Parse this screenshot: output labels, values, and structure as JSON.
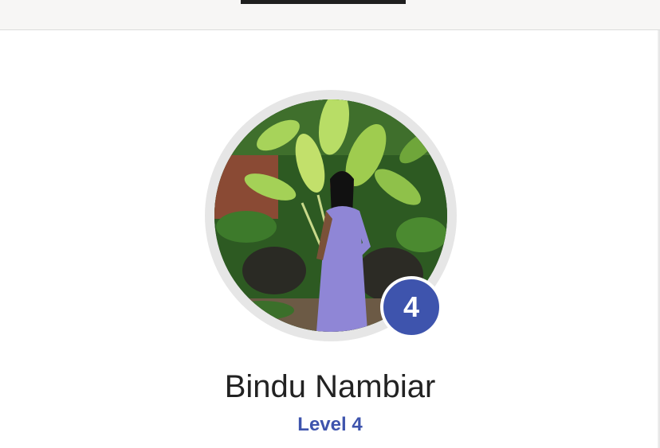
{
  "profile": {
    "name": "Bindu Nambiar",
    "level_label": "Level 4",
    "level_badge": "4",
    "avatar_icon": "user-avatar-photo"
  },
  "colors": {
    "accent": "#3e54ad",
    "name_text": "#222222",
    "ring": "#e6e6e6",
    "top_bar": "#f7f6f5",
    "tab_indicator": "#1f1f1f"
  }
}
